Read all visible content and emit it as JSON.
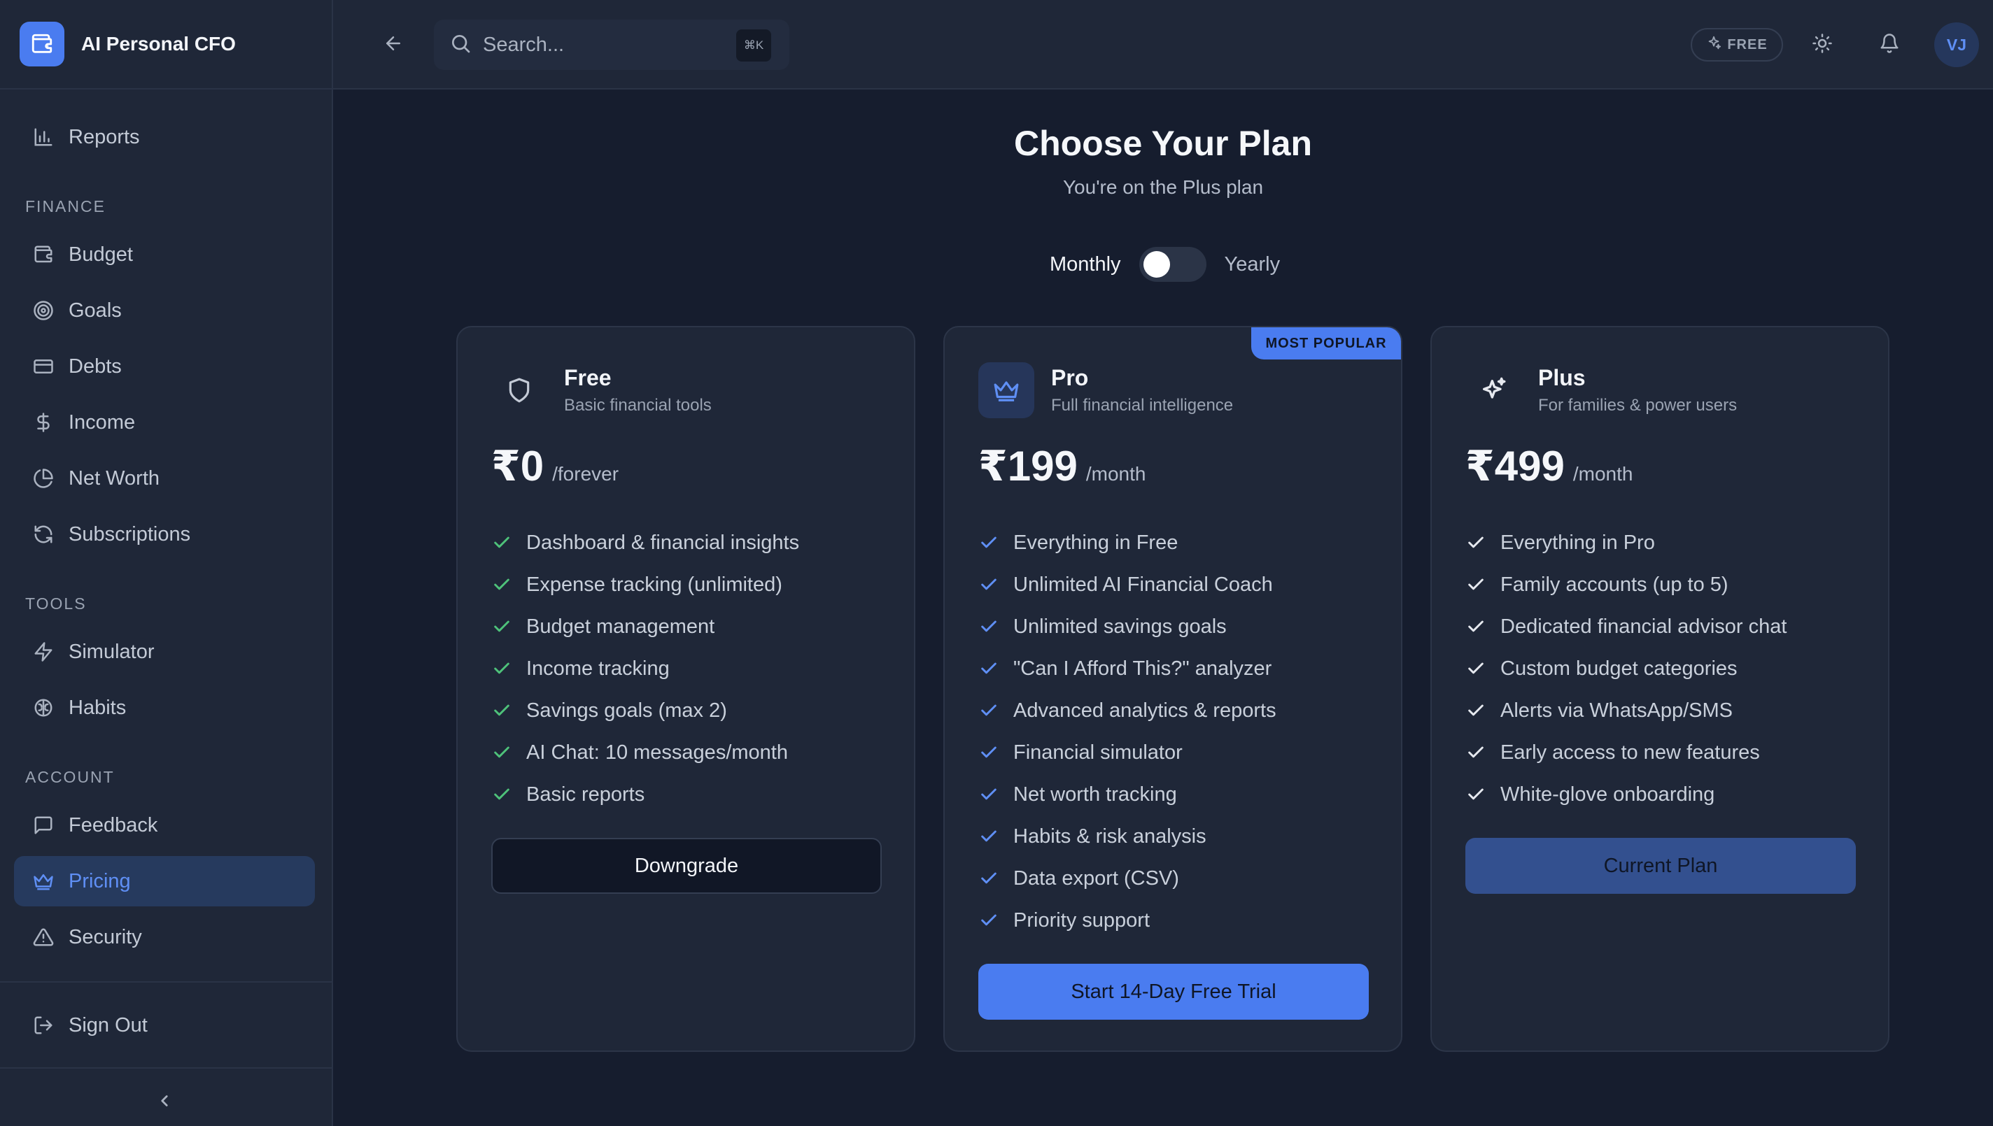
{
  "app": {
    "name": "AI Personal CFO"
  },
  "sidebar": {
    "top_items": [
      {
        "label": "Reports",
        "icon": "bar-chart-icon"
      }
    ],
    "sections": [
      {
        "label": "FINANCE",
        "items": [
          {
            "label": "Budget",
            "icon": "wallet-icon"
          },
          {
            "label": "Goals",
            "icon": "target-icon"
          },
          {
            "label": "Debts",
            "icon": "credit-card-icon"
          },
          {
            "label": "Income",
            "icon": "dollar-icon"
          },
          {
            "label": "Net Worth",
            "icon": "pie-chart-icon"
          },
          {
            "label": "Subscriptions",
            "icon": "refresh-icon"
          }
        ]
      },
      {
        "label": "TOOLS",
        "items": [
          {
            "label": "Simulator",
            "icon": "lightning-icon"
          },
          {
            "label": "Habits",
            "icon": "brain-icon"
          }
        ]
      },
      {
        "label": "ACCOUNT",
        "items": [
          {
            "label": "Feedback",
            "icon": "message-icon"
          },
          {
            "label": "Pricing",
            "icon": "crown-icon",
            "active": true
          },
          {
            "label": "Security",
            "icon": "alert-triangle-icon"
          }
        ]
      }
    ],
    "sign_out": "Sign Out"
  },
  "header": {
    "search_placeholder": "Search...",
    "shortcut": "⌘K",
    "plan_badge": "FREE",
    "avatar_initials": "VJ"
  },
  "main": {
    "title": "Choose Your Plan",
    "subtitle": "You're on the Plus plan",
    "billing": {
      "monthly": "Monthly",
      "yearly": "Yearly",
      "selected": "Monthly"
    },
    "plans": [
      {
        "name": "Free",
        "description": "Basic financial tools",
        "icon": "shield-icon",
        "price": "₹0",
        "period": "/forever",
        "features": [
          "Dashboard & financial insights",
          "Expense tracking (unlimited)",
          "Budget management",
          "Income tracking",
          "Savings goals (max 2)",
          "AI Chat: 10 messages/month",
          "Basic reports"
        ],
        "cta": "Downgrade"
      },
      {
        "name": "Pro",
        "description": "Full financial intelligence",
        "icon": "crown-icon",
        "badge": "MOST POPULAR",
        "price": "₹199",
        "period": "/month",
        "features": [
          "Everything in Free",
          "Unlimited AI Financial Coach",
          "Unlimited savings goals",
          "\"Can I Afford This?\" analyzer",
          "Advanced analytics & reports",
          "Financial simulator",
          "Net worth tracking",
          "Habits & risk analysis",
          "Data export (CSV)",
          "Priority support"
        ],
        "cta": "Start 14-Day Free Trial"
      },
      {
        "name": "Plus",
        "description": "For families & power users",
        "icon": "sparkles-icon",
        "price": "₹499",
        "period": "/month",
        "features": [
          "Everything in Pro",
          "Family accounts (up to 5)",
          "Dedicated financial advisor chat",
          "Custom budget categories",
          "Alerts via WhatsApp/SMS",
          "Early access to new features",
          "White-glove onboarding"
        ],
        "cta": "Current Plan"
      }
    ]
  },
  "colors": {
    "accent": "#4a7cf0",
    "background": "#161d2e",
    "surface": "#1f2738",
    "check_green": "#4ec27a",
    "check_blue": "#5f8ff5",
    "check_white": "#e6e9ef"
  }
}
